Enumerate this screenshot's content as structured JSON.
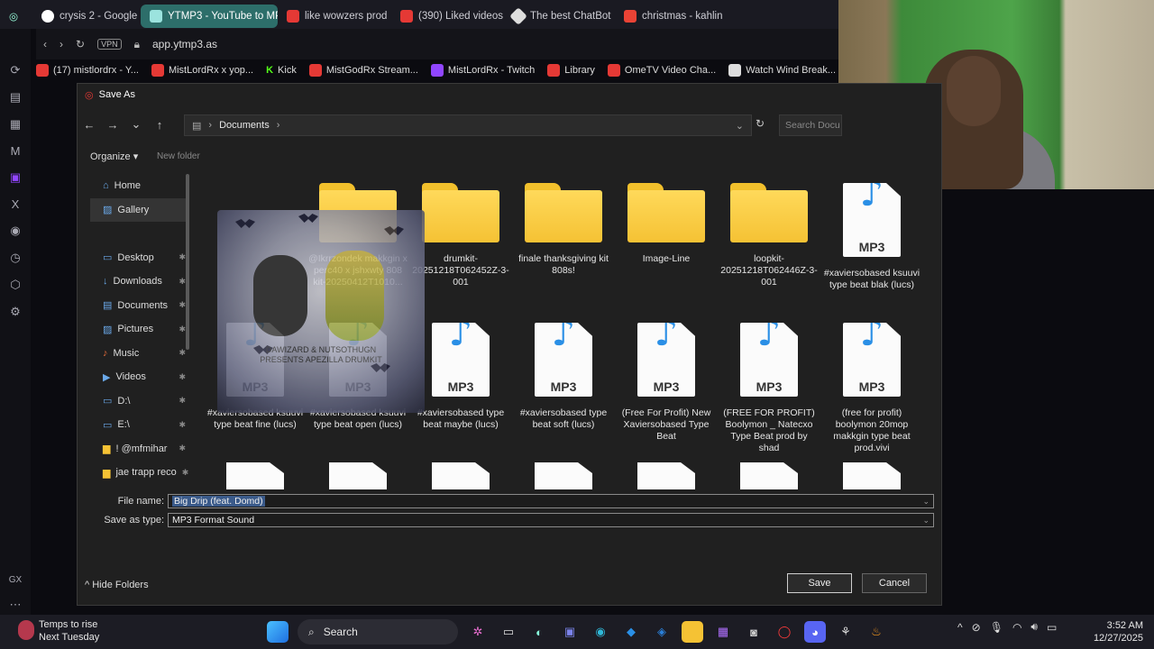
{
  "browser": {
    "tabs": [
      {
        "label": "crysis 2 - Google S",
        "color": "#fff"
      },
      {
        "label": "YTMP3 - YouTube to MP",
        "color": "#2aa7a0",
        "active": true
      },
      {
        "label": "like wowzers prod",
        "color": "#e53935"
      },
      {
        "label": "(390) Liked videos",
        "color": "#e53935"
      },
      {
        "label": "The best ChatBot",
        "color": "#ddd"
      },
      {
        "label": "christmas - kahlin",
        "color": "#ea4335"
      }
    ],
    "url": "app.ytmp3.as",
    "vpn": "VPN",
    "bookmarks": [
      "(17) mistlordrx - Y...",
      "MistLordRx x yop...",
      "Kick",
      "MistGodRx Stream...",
      "MistLordRx - Twitch",
      "Library",
      "OmeTV Video Cha...",
      "Watch Wind Break..."
    ]
  },
  "dialog": {
    "title": "Save As",
    "breadcrumb": "Documents",
    "search_placeholder": "Search Docu",
    "organize": "Organize",
    "new_folder": "New folder",
    "nav_items": [
      {
        "label": "Home",
        "icon": "home-icon",
        "pinned": false
      },
      {
        "label": "Gallery",
        "icon": "gallery-icon",
        "pinned": false
      },
      {
        "label": "",
        "icon": "",
        "pinned": false
      },
      {
        "label": "Desktop",
        "icon": "desktop-icon",
        "pinned": true
      },
      {
        "label": "Downloads",
        "icon": "download-icon",
        "pinned": true
      },
      {
        "label": "Documents",
        "icon": "documents-icon",
        "pinned": true
      },
      {
        "label": "Pictures",
        "icon": "pictures-icon",
        "pinned": true
      },
      {
        "label": "Music",
        "icon": "music-icon",
        "pinned": true
      },
      {
        "label": "Videos",
        "icon": "videos-icon",
        "pinned": true
      },
      {
        "label": "D:\\",
        "icon": "drive-icon",
        "pinned": true
      },
      {
        "label": "E:\\",
        "icon": "drive-icon",
        "pinned": true
      },
      {
        "label": "! @mfmihar",
        "icon": "folder-icon",
        "pinned": true
      },
      {
        "label": "jae trapp reco",
        "icon": "folder-icon",
        "pinned": true
      }
    ],
    "files_row1": [
      {
        "type": "folder",
        "name": "@Ikrrzondek makkgin x perc40 x jshxwty 808 kit-20250412T1010..."
      },
      {
        "type": "folder",
        "name": "drumkit-20251218T062452Z-3-001"
      },
      {
        "type": "folder",
        "name": "finale thanksgiving kit 808s!"
      },
      {
        "type": "folder",
        "name": "Image-Line"
      },
      {
        "type": "folder",
        "name": "loopkit-20251218T062446Z-3-001"
      },
      {
        "type": "mp3",
        "name": "#xaviersobased ksuuvi type beat  blak (lucs)"
      }
    ],
    "files_row2": [
      {
        "type": "mp3",
        "name": "#xaviersobased ksuuvi type beat  fine (lucs)"
      },
      {
        "type": "mp3",
        "name": "#xaviersobased ksuuvi type beat  open  (lucs)"
      },
      {
        "type": "mp3",
        "name": "#xaviersobased type beat  maybe  (lucs)"
      },
      {
        "type": "mp3",
        "name": "#xaviersobased type beat  soft  (lucs)"
      },
      {
        "type": "mp3",
        "name": "(Free For Profit)  New Xaviersobased Type Beat"
      },
      {
        "type": "mp3",
        "name": "(FREE FOR PROFIT) Boolymon _ Natecxo Type Beat prod by shad"
      },
      {
        "type": "mp3",
        "name": "(free for profit) boolymon 20mop makkgin type beat prod.vivi"
      }
    ],
    "mp3_label": "MP3",
    "overlay_text": "DAWIZARD & NUTSOTHUGN PRESENTS APEZILLA DRUMKIT",
    "file_name_label": "File name:",
    "file_name_value": "Big Drip (feat. Domd)",
    "save_type_label": "Save as type:",
    "save_type_value": "MP3 Format Sound",
    "hide_folders": "Hide Folders",
    "save": "Save",
    "cancel": "Cancel"
  },
  "taskbar": {
    "weather_line1": "Temps to rise",
    "weather_line2": "Next Tuesday",
    "search": "Search",
    "time": "3:52 AM",
    "date": "12/27/2025"
  },
  "colors": {
    "accent": "#2d6e6a",
    "folder": "#f5c234",
    "note": "#2a8fe6"
  }
}
